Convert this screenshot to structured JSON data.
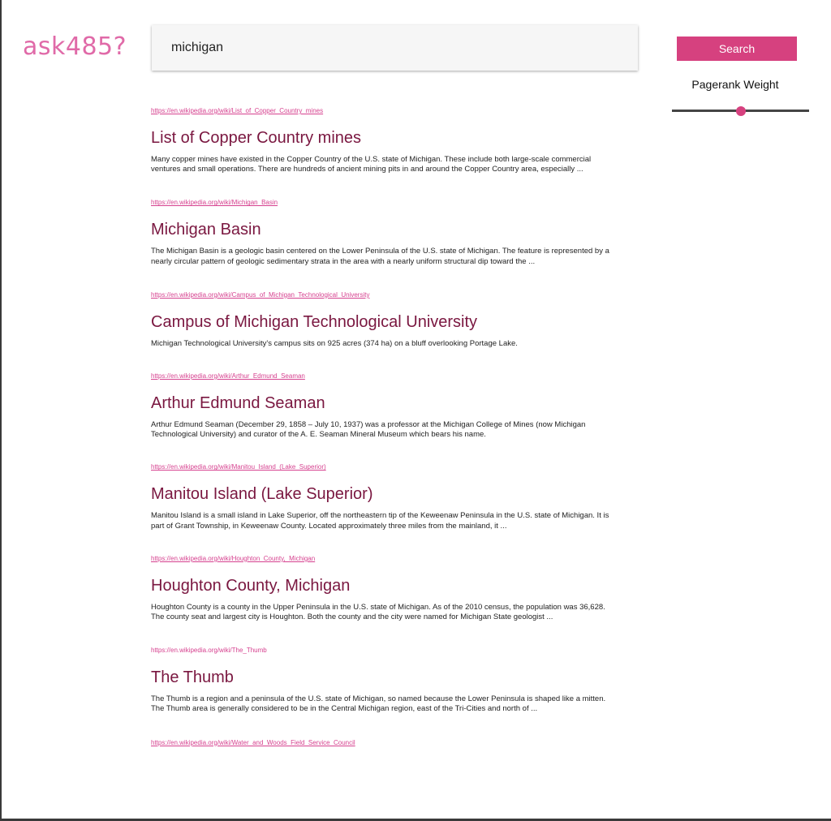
{
  "app": {
    "logo": "ask485?"
  },
  "search": {
    "query": "michigan",
    "button_label": "Search"
  },
  "pagerank": {
    "label": "Pagerank Weight",
    "value": 0.5
  },
  "colors": {
    "accent": "#d6417f",
    "logo": "#e06aa8",
    "title": "#7a1740",
    "link": "#d6418f"
  },
  "results": [
    {
      "url": "https://en.wikipedia.org/wiki/List_of_Copper_Country_mines",
      "title": "List of Copper Country mines",
      "summary": "Many copper mines have existed in the Copper Country of the U.S. state of Michigan. These include both large-scale commercial ventures and small operations. There are hundreds of ancient mining pits in and around the Copper Country area, especially ..."
    },
    {
      "url": "https://en.wikipedia.org/wiki/Michigan_Basin",
      "title": "Michigan Basin",
      "summary": "The Michigan Basin is a geologic basin centered on the Lower Peninsula of the U.S. state of Michigan. The feature is represented by a nearly circular pattern of geologic sedimentary strata in the area with a nearly uniform structural dip toward the ..."
    },
    {
      "url": "https://en.wikipedia.org/wiki/Campus_of_Michigan_Technological_University",
      "title": "Campus of Michigan Technological University",
      "summary": "Michigan Technological University's campus sits on 925 acres (374 ha) on a bluff overlooking Portage Lake."
    },
    {
      "url": "https://en.wikipedia.org/wiki/Arthur_Edmund_Seaman",
      "title": "Arthur Edmund Seaman",
      "summary": "Arthur Edmund Seaman (December 29, 1858 – July 10, 1937) was a professor at the Michigan College of Mines (now Michigan Technological University) and curator of the A. E. Seaman Mineral Museum which bears his name."
    },
    {
      "url": "https://en.wikipedia.org/wiki/Manitou_Island_(Lake_Superior)",
      "title": "Manitou Island (Lake Superior)",
      "summary": "Manitou Island is a small island in Lake Superior, off the northeastern tip of the Keweenaw Peninsula in the U.S. state of Michigan. It is part of Grant Township, in Keweenaw County. Located approximately three miles from the mainland, it ..."
    },
    {
      "url": "https://en.wikipedia.org/wiki/Houghton_County,_Michigan",
      "title": "Houghton County, Michigan",
      "summary": "Houghton County is a county in the Upper Peninsula in the U.S. state of Michigan. As of the 2010 census, the population was 36,628. The county seat and largest city is Houghton. Both the county and the city were named for Michigan State geologist ..."
    },
    {
      "url": "https://en.wikipedia.org/wiki/The_Thumb",
      "title": "The Thumb",
      "summary": "The Thumb is a region and a peninsula of the U.S. state of Michigan, so named because the Lower Peninsula is shaped like a mitten. The Thumb area is generally considered to be in the Central Michigan region, east of the Tri-Cities and north of ..."
    },
    {
      "url": "https://en.wikipedia.org/wiki/Water_and_Woods_Field_Service_Council",
      "title": "",
      "summary": ""
    }
  ]
}
